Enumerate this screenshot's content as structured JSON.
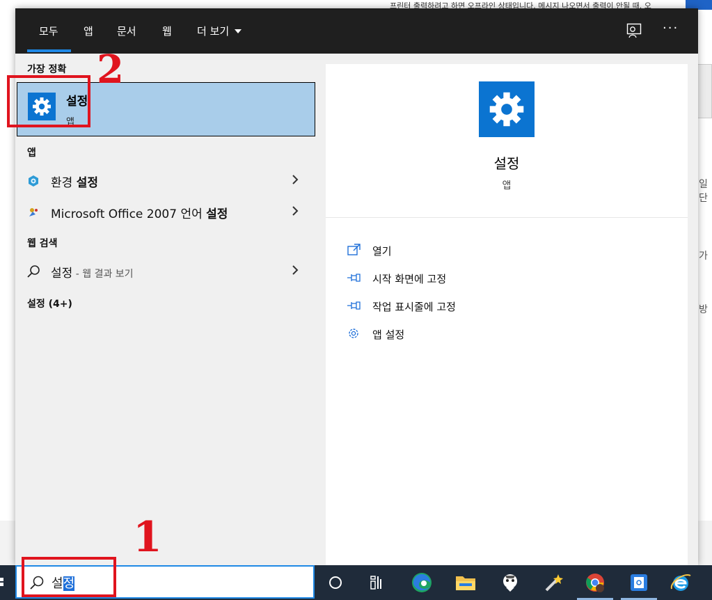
{
  "background": {
    "notice_text": "프린터 출력하려고 하면 오프라인 상태입니다. 메시지 나오면서 출력이 안될 때. 오",
    "side_chars": [
      "일단",
      "가",
      "방"
    ]
  },
  "menu": {
    "tabs": [
      "모두",
      "앱",
      "문서",
      "웹",
      "더 보기"
    ],
    "more_label": "···",
    "best_match": {
      "heading": "가장 정확",
      "title": "설정",
      "subtitle": "앱"
    },
    "apps_heading": "앱",
    "apps": [
      {
        "prefix": "환경 ",
        "bold": "설정"
      },
      {
        "prefix": "Microsoft Office 2007 언어 ",
        "bold": "설정"
      }
    ],
    "web_heading": "웹 검색",
    "web_item": {
      "text": "설정",
      "sub": " - 웹 결과 보기"
    },
    "settings_heading": "설정 (4+)"
  },
  "preview": {
    "title": "설정",
    "subtitle": "앱",
    "actions": [
      "열기",
      "시작 화면에 고정",
      "작업 표시줄에 고정",
      "앱 설정"
    ]
  },
  "search": {
    "typed_plain": "설",
    "typed_selected": "정"
  },
  "annotations": {
    "mark_1": "1",
    "mark_2": "2"
  },
  "colors": {
    "accent": "#1e88e5",
    "app_tile": "#0b74d1",
    "highlight": "#a9cdea",
    "annotation": "#e0141e"
  }
}
